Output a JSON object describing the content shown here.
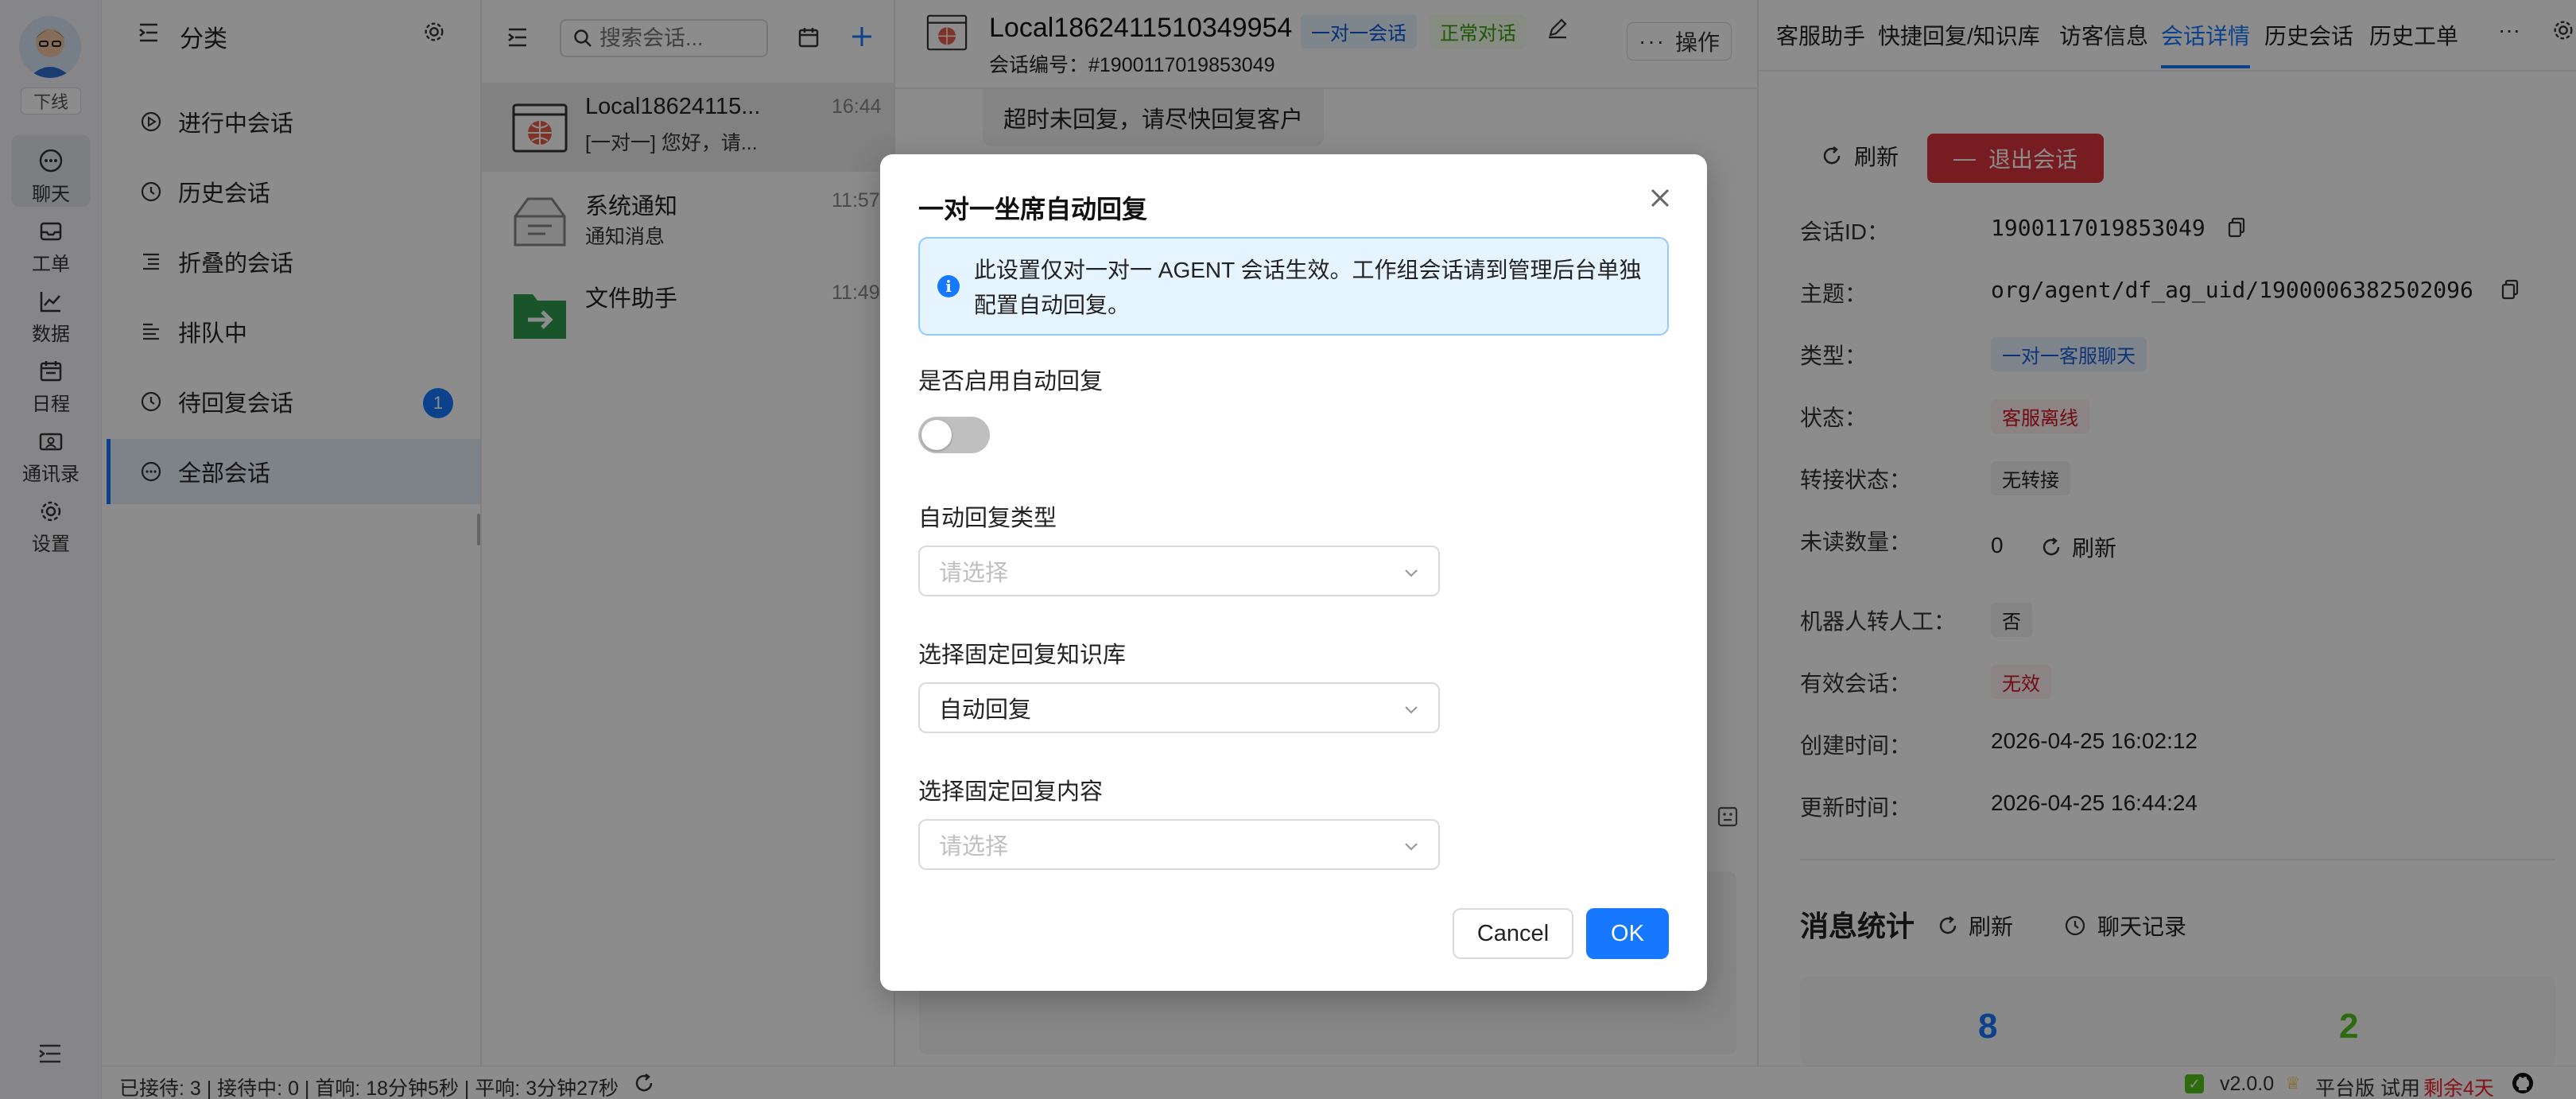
{
  "rail": {
    "status": "下线",
    "items": [
      {
        "label": "聊天",
        "icon": "chat-icon"
      },
      {
        "label": "工单",
        "icon": "inbox-icon"
      },
      {
        "label": "数据",
        "icon": "chart-icon"
      },
      {
        "label": "日程",
        "icon": "calendar-icon"
      },
      {
        "label": "通讯录",
        "icon": "contacts-icon"
      },
      {
        "label": "设置",
        "icon": "gear-icon"
      }
    ]
  },
  "category": {
    "title": "分类",
    "items": [
      {
        "label": "进行中会话"
      },
      {
        "label": "历史会话"
      },
      {
        "label": "折叠的会话"
      },
      {
        "label": "排队中"
      },
      {
        "label": "待回复会话",
        "badge": "1"
      },
      {
        "label": "全部会话"
      }
    ]
  },
  "list": {
    "search_placeholder": "搜索会话...",
    "items": [
      {
        "name": "Local18624115...",
        "time": "16:44",
        "preview": "[一对一] 您好，请..."
      },
      {
        "name": "系统通知",
        "time": "11:57",
        "preview": "通知消息"
      },
      {
        "name": "文件助手",
        "time": "11:49",
        "preview": ""
      }
    ]
  },
  "chat": {
    "title": "Local1862411510349954",
    "tag1": "一对一会话",
    "tag2": "正常对话",
    "subtitle": "会话编号：#1900117019853049",
    "ops_label": "操作",
    "message": "超时未回复，请尽快回复客户"
  },
  "right": {
    "tabs": [
      "客服助手",
      "快捷回复/知识库",
      "访客信息",
      "会话详情",
      "历史会话",
      "历史工单"
    ],
    "active_tab": "会话详情",
    "refresh_label": "刷新",
    "exit_label": "退出会话",
    "rows": {
      "id_label": "会话ID：",
      "id_value": "1900117019853049",
      "topic_label": "主题：",
      "topic_value": "org/agent/df_ag_uid/1900006382502096",
      "type_label": "类型：",
      "type_value": "一对一客服聊天",
      "state_label": "状态：",
      "state_value": "客服离线",
      "transfer_label": "转接状态：",
      "transfer_value": "无转接",
      "unread_label": "未读数量：",
      "unread_value": "0",
      "unread_refresh": "刷新",
      "robot_label": "机器人转人工：",
      "robot_value": "否",
      "valid_label": "有效会话：",
      "valid_value": "无效",
      "created_label": "创建时间：",
      "created_value": "2026-04-25 16:02:12",
      "updated_label": "更新时间：",
      "updated_value": "2026-04-25 16:44:24"
    },
    "stats": {
      "title": "消息统计",
      "refresh_label": "刷新",
      "history_label": "聊天记录",
      "value_a": "8",
      "value_b": "2"
    }
  },
  "statusbar": {
    "text": "已接待: 3 | 接待中: 0 | 首响: 18分钟5秒 | 平响: 3分钟27秒",
    "version": "v2.0.0",
    "edition": "平台版",
    "trial": "试用",
    "remaining": "剩余4天"
  },
  "modal": {
    "title": "一对一坐席自动回复",
    "info": "此设置仅对一对一 AGENT 会话生效。工作组会话请到管理后台单独配置自动回复。",
    "enable_label": "是否启用自动回复",
    "enable_on": false,
    "type_label": "自动回复类型",
    "type_placeholder": "请选择",
    "kb_label": "选择固定回复知识库",
    "kb_value": "自动回复",
    "content_label": "选择固定回复内容",
    "content_placeholder": "请选择",
    "cancel_label": "Cancel",
    "ok_label": "OK"
  },
  "colors": {
    "primary": "#1677ff",
    "danger": "#d9363e",
    "overlay": "rgba(0,0,0,0.45)",
    "stat_blue": "#1677ff",
    "stat_green": "#52c41a"
  }
}
